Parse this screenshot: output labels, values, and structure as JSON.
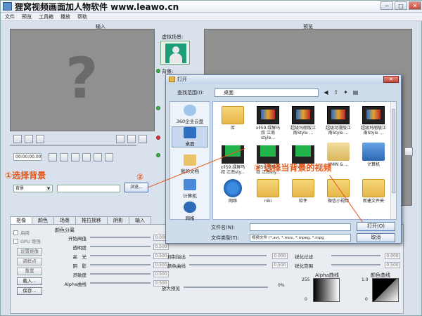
{
  "window": {
    "title": "狸窝视频画面加人物软件   www.leawo.cn",
    "buttons": [
      "─",
      "□",
      "✕"
    ]
  },
  "menu": [
    "文件",
    "预览",
    "工具箱",
    "播放",
    "帮助"
  ],
  "input_panel": {
    "label": "输入",
    "background_scene_label": "虚拟场景:",
    "background_label": "背景:",
    "time": "00:00:00.00"
  },
  "preview_panel": {
    "label": "预览"
  },
  "bg_select": {
    "value": "背景",
    "browse_label": "浏览..."
  },
  "annotations": {
    "step1": "①选择背景",
    "step2": "②",
    "step3": "③ 选择当背景的视频"
  },
  "tabs": [
    "抠像",
    "颜色",
    "场景",
    "推拉摇移",
    "阴影",
    "输入"
  ],
  "keying": {
    "enable_label": "启用",
    "gpu_label": "GPU 增强",
    "buttons": [
      "设置抠像",
      "调样点",
      "重置",
      "载入...",
      "保存..."
    ],
    "group_title": "颜色分离",
    "params": [
      {
        "label": "开始阀值",
        "value": "0.000"
      },
      {
        "label": "透明度",
        "value": "0.500"
      },
      {
        "label": "高　光",
        "value": "0.500"
      },
      {
        "label": "阴　影",
        "value": "0.500"
      },
      {
        "label": "灵敏度",
        "value": "0.500"
      },
      {
        "label": "Alpha曲线",
        "value": "0.500"
      }
    ]
  },
  "right_params": {
    "left": [
      {
        "label": "抑制溢出",
        "value": "0.000"
      },
      {
        "label": "颜色曲线",
        "value": "0.500"
      }
    ],
    "blur_label": "放大预览",
    "blur_value": "0%",
    "right": [
      {
        "label": "锐化过滤",
        "value": "0.000"
      },
      {
        "label": "锐化范围",
        "value": "0.500"
      }
    ],
    "alpha_curve_title": "Alpha曲线",
    "color_curve_title": "颜色曲线",
    "alpha_axis": [
      "255",
      "0"
    ],
    "color_axis": [
      "1.0",
      "0"
    ]
  },
  "dialog": {
    "title": "打开",
    "look_in_label": "查找范围(I):",
    "look_in_value": "桌面",
    "places": [
      "360企业云盘",
      "桌面",
      "我的文档",
      "计算机",
      "网络"
    ],
    "files": [
      {
        "name": "库",
        "type": "folder"
      },
      {
        "name": "xll59.绿屏马叔 江南style...",
        "type": "video"
      },
      {
        "name": "超级玛丽版江南Style ...",
        "type": "video"
      },
      {
        "name": "超级动漫版江南Style ...",
        "type": "video"
      },
      {
        "name": "超级玛丽版江南Style ...",
        "type": "video"
      },
      {
        "name": "xll59.绿屏马叔 江南sty...",
        "type": "greenvid"
      },
      {
        "name": "xll59.绿屏马叔 江南sty...",
        "type": "greenvid"
      },
      {
        "name": "xll5...",
        "type": "greenvid"
      },
      {
        "name": "JIMIN & ...",
        "type": "user"
      },
      {
        "name": "计算机",
        "type": "computer"
      },
      {
        "name": "网络",
        "type": "network"
      },
      {
        "name": "niki",
        "type": "folder"
      },
      {
        "name": "软件",
        "type": "folder"
      },
      {
        "name": "微信小视频",
        "type": "folder"
      },
      {
        "name": "新建文件夹",
        "type": "folder"
      }
    ],
    "filename_label": "文件名(N):",
    "filename_value": "",
    "filetype_label": "文件类型(T):",
    "filetype_value": "视频文件 (*.avi, *.mov, *.mpeg, *.mpg",
    "open_label": "打开(O)",
    "cancel_label": "取消"
  }
}
